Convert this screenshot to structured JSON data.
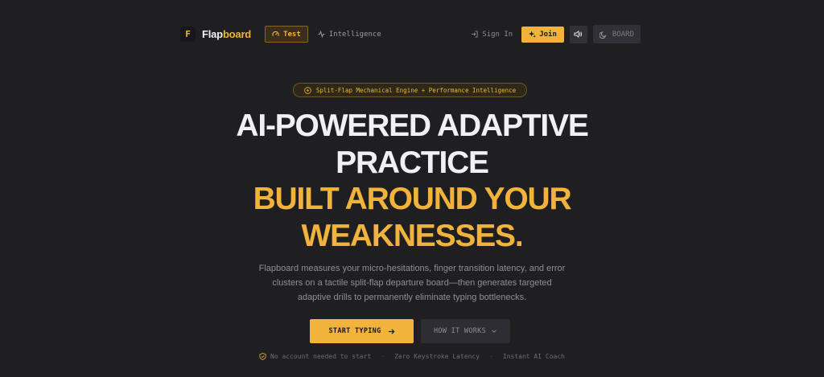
{
  "nav": {
    "logo_letter": "F",
    "brand_part1": "Flap",
    "brand_part2": "board",
    "test_label": "Test",
    "intelligence_label": "Intelligence",
    "signin_label": "Sign In",
    "join_label": "Join",
    "board_label": "BOARD"
  },
  "hero": {
    "pill_text": "Split-Flap Mechanical Engine + Performance Intelligence",
    "headline_line1": "AI-POWERED ADAPTIVE",
    "headline_line2": "PRACTICE",
    "headline_line3": "BUILT AROUND YOUR",
    "headline_line4": "WEAKNESSES.",
    "description_line1": "Flapboard measures your micro-hesitations, finger transition latency, and error",
    "description_line2": "clusters on a tactile split-flap departure board—then generates targeted",
    "description_line3": "adaptive drills to permanently eliminate typing bottlenecks.",
    "start_label": "START TYPING",
    "how_label": "HOW IT WORKS"
  },
  "notes": {
    "note1": "No account needed to start",
    "note2": "Zero Keystroke Latency",
    "note3": "Instant AI Coach",
    "separator": "·"
  },
  "colors": {
    "background": "#1f1f22",
    "accent": "#f2b33d",
    "text_primary": "#f1f1f3",
    "text_muted": "#8e8e97"
  },
  "icons": {
    "test": "gauge-icon",
    "intelligence": "activity-icon",
    "signin": "login-icon",
    "join": "sparkles-icon",
    "sound": "volume-icon",
    "board": "moon-icon",
    "pill": "zap-icon",
    "start": "arrow-right-icon",
    "how": "chevron-down-icon",
    "note1": "shield-check-icon"
  }
}
